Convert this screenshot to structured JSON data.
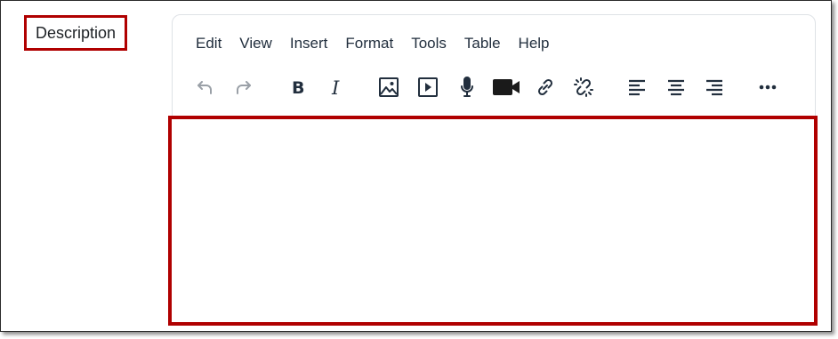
{
  "field": {
    "label": "Description"
  },
  "menubar": {
    "items": [
      "Edit",
      "View",
      "Insert",
      "Format",
      "Tools",
      "Table",
      "Help"
    ]
  },
  "toolbar": {
    "buttons": [
      "undo",
      "redo",
      "bold",
      "italic",
      "image",
      "media",
      "record-audio",
      "record-video",
      "link",
      "unlink",
      "align-left",
      "align-center",
      "align-right",
      "more"
    ]
  },
  "editor": {
    "content": ""
  },
  "colors": {
    "highlight_border": "#b00000",
    "icon": "#222f3e",
    "editor_border": "#dee2e6"
  }
}
